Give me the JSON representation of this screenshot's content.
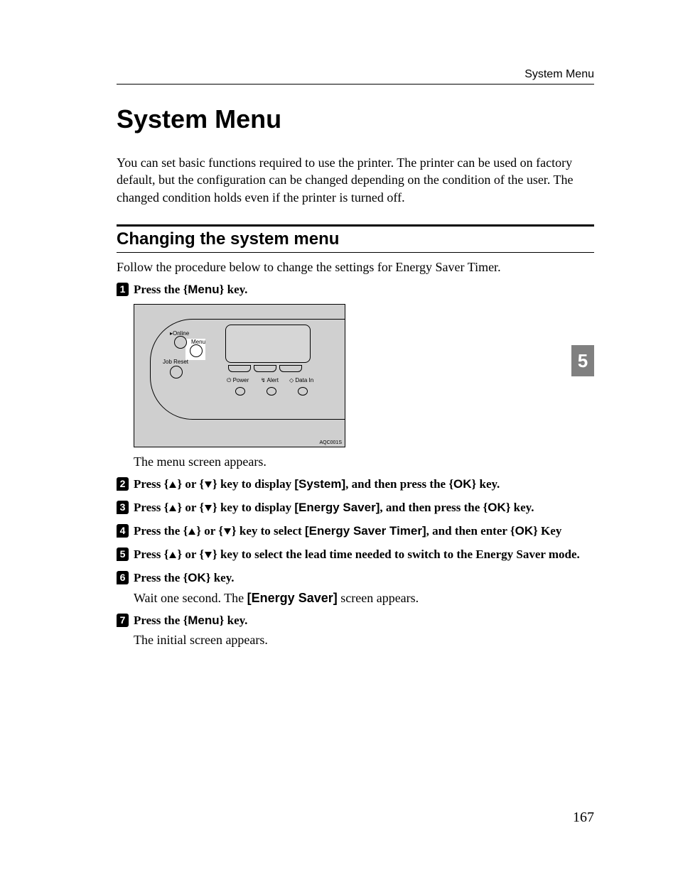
{
  "header": {
    "running_head": "System Menu"
  },
  "title": "System Menu",
  "intro": "You can set basic functions required to use the printer. The printer can be used on factory default, but the configuration can be changed depending on the condition of the user. The changed condition holds even if the printer is turned off.",
  "section": {
    "heading": "Changing the system menu",
    "intro": "Follow the procedure below to change the settings for Energy Saver Timer."
  },
  "steps": [
    {
      "n": "1",
      "pre": "Press the ",
      "key": "Menu",
      "post": " key."
    },
    {
      "n": "2",
      "pre": "Press ",
      "mid": " or ",
      "mid2": " key to display ",
      "label": "[System]",
      "tail": ", and then press the ",
      "key": "OK",
      "post": " key."
    },
    {
      "n": "3",
      "pre": "Press ",
      "mid": " or ",
      "mid2": " key to display ",
      "label": "[Energy Saver]",
      "tail": ", and then press the ",
      "key": "OK",
      "post": " key."
    },
    {
      "n": "4",
      "pre": "Press the ",
      "mid": " or ",
      "mid2": " key to select ",
      "label": "[Energy Saver Timer]",
      "tail": ", and then enter ",
      "key": "OK",
      "post": " Key"
    },
    {
      "n": "5",
      "pre": "Press ",
      "mid": " or ",
      "mid2": " key to select the lead time needed to switch to the Energy Saver mode."
    },
    {
      "n": "6",
      "pre": "Press the ",
      "key": "OK",
      "post": " key."
    },
    {
      "n": "7",
      "pre": "Press the ",
      "key": "Menu",
      "post": " key."
    }
  ],
  "notes": {
    "after1": "The menu screen appears.",
    "after6_pre": "Wait one second. The ",
    "after6_label": "[Energy Saver]",
    "after6_post": " screen appears.",
    "after7": "The initial screen appears."
  },
  "panel": {
    "online": "Online",
    "menu": "Menu",
    "jobreset": "Job Reset",
    "power": "Power",
    "alert": "Alert",
    "data": "Data In",
    "code": "AQC001S"
  },
  "side_tab": "5",
  "page_number": "167",
  "glyph": {
    "lbracket": "{",
    "rbracket": "}",
    "bullet_online": "▸"
  }
}
